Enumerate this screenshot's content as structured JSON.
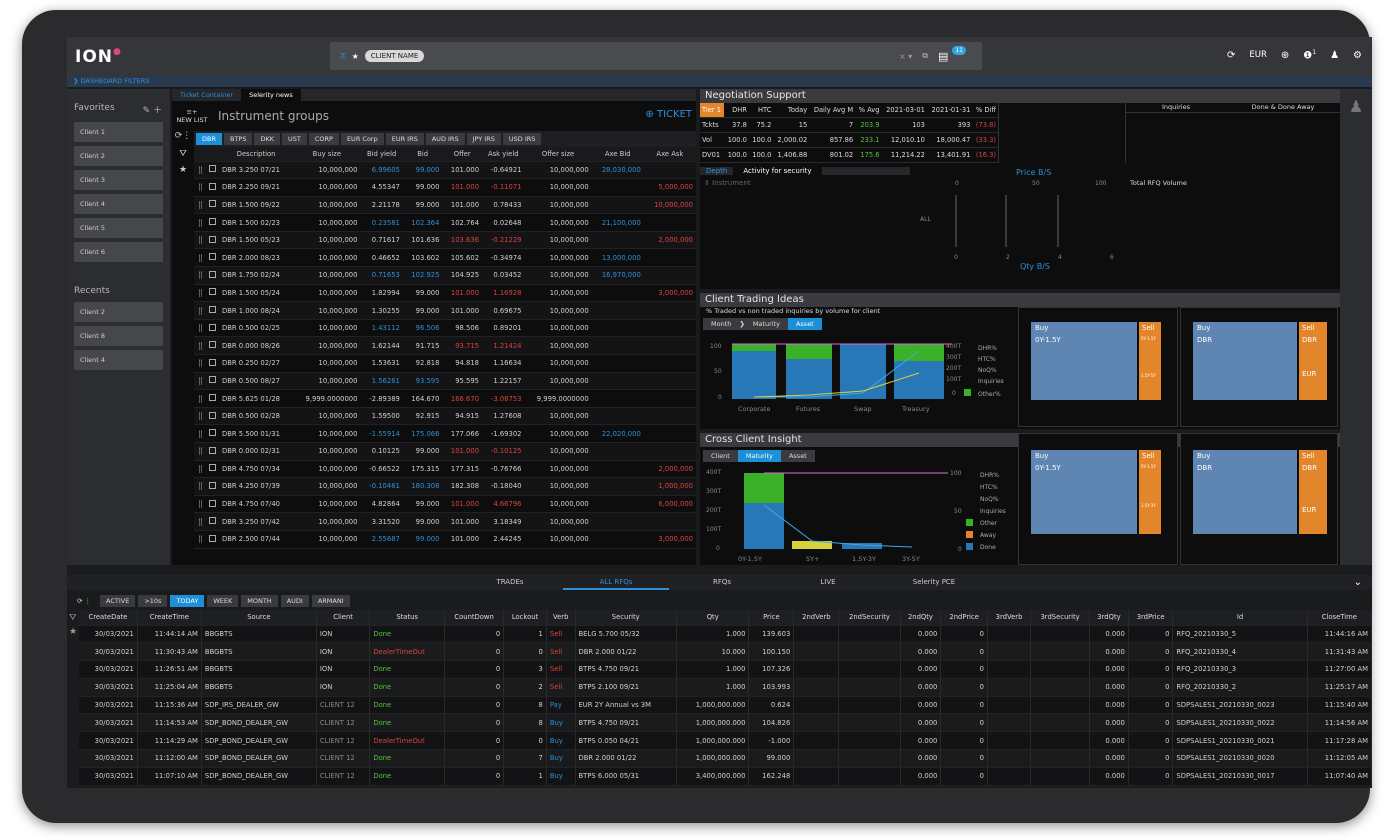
{
  "topbar": {
    "logo": "ION",
    "client_pill": "CLIENT NAME",
    "chat_badge": "11",
    "currency": "EUR",
    "alerts": "1"
  },
  "filterbar": {
    "label": "DASHBOARD FILTERS"
  },
  "sidebar": {
    "favorites_title": "Favorites",
    "favorites": [
      "Client 1",
      "Client 2",
      "Client 3",
      "Client 4",
      "Client 5",
      "Client 6"
    ],
    "recents_title": "Recents",
    "recents": [
      "Client 2",
      "Client 8",
      "Client 4"
    ]
  },
  "instruments": {
    "tabs": [
      "Ticket Container",
      "Selerity news"
    ],
    "new_list": "NEW LIST",
    "title": "Instrument groups",
    "ticket": "TICKET",
    "groups": [
      "DBR",
      "BTPS",
      "DKK",
      "UST",
      "CORP",
      "EUR Corp",
      "EUR IRS",
      "AUD IRS",
      "JPY IRS",
      "USD IRS"
    ],
    "columns": [
      "Description",
      "Buy size",
      "Bid yield",
      "Bid",
      "Offer",
      "Ask yield",
      "Offer size",
      "Axe Bid",
      "Axe Ask"
    ],
    "rows": [
      [
        "DBR 3.250 07/21",
        "10,000,000",
        "6.99605",
        "99.000",
        "101.000",
        "-0.64921",
        "10,000,000",
        "28,030,000",
        ""
      ],
      [
        "DBR 2.250 09/21",
        "10,000,000",
        "4.55347",
        "99.000",
        "101.000",
        "-0.11071",
        "10,000,000",
        "",
        "5,000,000"
      ],
      [
        "DBR 1.500 09/22",
        "10,000,000",
        "2.21178",
        "99.000",
        "101.000",
        "0.78433",
        "10,000,000",
        "",
        "10,000,000"
      ],
      [
        "DBR 1.500 02/23",
        "10,000,000",
        "0.23581",
        "102.364",
        "102.764",
        "0.02648",
        "10,000,000",
        "21,100,000",
        ""
      ],
      [
        "DBR 1.500 05/23",
        "10,000,000",
        "0.71617",
        "101.636",
        "103.636",
        "-0.21229",
        "10,000,000",
        "",
        "2,000,000"
      ],
      [
        "DBR 2.000 08/23",
        "10,000,000",
        "0.46652",
        "103.602",
        "105.602",
        "-0.34974",
        "10,000,000",
        "13,000,000",
        ""
      ],
      [
        "DBR 1.750 02/24",
        "10,000,000",
        "0.71653",
        "102.925",
        "104.925",
        "0.03452",
        "10,000,000",
        "16,970,000",
        ""
      ],
      [
        "DBR 1.500 05/24",
        "10,000,000",
        "1.82994",
        "99.000",
        "101.000",
        "1.16928",
        "10,000,000",
        "",
        "3,000,000"
      ],
      [
        "DBR 1.000 08/24",
        "10,000,000",
        "1.30255",
        "99.000",
        "101.000",
        "0.69675",
        "10,000,000",
        "",
        ""
      ],
      [
        "DBR 0.500 02/25",
        "10,000,000",
        "1.43112",
        "96.506",
        "98.506",
        "0.89201",
        "10,000,000",
        "",
        ""
      ],
      [
        "DBR 0.000 08/26",
        "10,000,000",
        "1.62144",
        "91.715",
        "93.715",
        "1.21424",
        "10,000,000",
        "",
        ""
      ],
      [
        "DBR 0.250 02/27",
        "10,000,000",
        "1.53631",
        "92.818",
        "94.818",
        "1.16634",
        "10,000,000",
        "",
        ""
      ],
      [
        "DBR 0.500 08/27",
        "10,000,000",
        "1.56261",
        "93.595",
        "95.595",
        "1.22157",
        "10,000,000",
        "",
        ""
      ],
      [
        "DBR 5.625 01/28",
        "9,999.0000000",
        "-2.89389",
        "164.670",
        "166.670",
        "-3.08753",
        "9,999.0000000",
        "",
        ""
      ],
      [
        "DBR 0.500 02/28",
        "10,000,000",
        "1.59500",
        "92.915",
        "94.915",
        "1.27608",
        "10,000,000",
        "",
        ""
      ],
      [
        "DBR 5.500 01/31",
        "10,000,000",
        "-1.55914",
        "175.066",
        "177.066",
        "-1.69302",
        "10,000,000",
        "22,020,000",
        ""
      ],
      [
        "DBR 0.000 02/31",
        "10,000,000",
        "0.10125",
        "99.000",
        "101.000",
        "-0.10125",
        "10,000,000",
        "",
        ""
      ],
      [
        "DBR 4.750 07/34",
        "10,000,000",
        "-0.66522",
        "175.315",
        "177.315",
        "-0.76766",
        "10,000,000",
        "",
        "2,000,000"
      ],
      [
        "DBR 4.250 07/39",
        "10,000,000",
        "-0.10461",
        "180.308",
        "182.308",
        "-0.18040",
        "10,000,000",
        "",
        "1,000,000"
      ],
      [
        "DBR 4.750 07/40",
        "10,000,000",
        "4.82864",
        "99.000",
        "101.000",
        "4.66796",
        "10,000,000",
        "",
        "6,000,000"
      ],
      [
        "DBR 3.250 07/42",
        "10,000,000",
        "3.31520",
        "99.000",
        "101.000",
        "3.18349",
        "10,000,000",
        "",
        ""
      ],
      [
        "DBR 2.500 07/44",
        "10,000,000",
        "2.55687",
        "99.000",
        "101.000",
        "2.44245",
        "10,000,000",
        "",
        "3,000,000"
      ]
    ]
  },
  "negotiation": {
    "title": "Negotiation Support",
    "header": [
      "Tier 1",
      "DHR",
      "HTC",
      "Today",
      "Daily Avg M",
      "% Avg",
      "2021-03-01",
      "2021-01-31",
      "% Diff"
    ],
    "rows": [
      [
        "Tckts",
        "37.8",
        "75.2",
        "15",
        "7",
        "203.9",
        "103",
        "393",
        "(73.8)"
      ],
      [
        "Vol",
        "100.0",
        "100.0",
        "2,000.02",
        "857.86",
        "233.1",
        "12,010.10",
        "18,000.47",
        "(33.3)"
      ],
      [
        "DV01",
        "100.0",
        "100.0",
        "1,406.88",
        "801.02",
        "175.6",
        "11,214.22",
        "13,401.91",
        "(16.3)"
      ]
    ],
    "inq_headers": [
      "Inquiries",
      "Done & Done Away"
    ],
    "depth_tabs": [
      "Depth",
      "Activity for security"
    ],
    "instrument_placeholder": "Instrument",
    "price_bs": "Price B/S",
    "qty_bs": "Qty B/S",
    "all": "ALL",
    "price_ticks": [
      "0",
      "50",
      "100"
    ],
    "qty_ticks": [
      "0",
      "2",
      "4",
      "6"
    ],
    "total_rfq": "Total RFQ Volume"
  },
  "ideas": {
    "title": "Client Trading Ideas",
    "subtitle": "% Traded vs non traded inquiries by volume for client",
    "crumbs": [
      "Month",
      "Maturity",
      "Asset"
    ],
    "categories": [
      "Corporate",
      "Futures",
      "Swap",
      "Treasury"
    ],
    "y_left": [
      "100",
      "50",
      "0"
    ],
    "y_right": [
      "400T",
      "300T",
      "200T",
      "100T",
      "0"
    ],
    "legend": [
      "DHR%",
      "HTC%",
      "NoQ%",
      "Inquiries",
      "Other%"
    ],
    "buy": "Buy",
    "sell": "Sell",
    "tenor1": "0Y-1.5Y",
    "sec1": "DBR",
    "sec2": "EUR",
    "sell_mini1": "0Y-1.5Y",
    "sell_mini2": "1.5Y-5Y"
  },
  "cross": {
    "title": "Cross Client Insight",
    "crumbs": [
      "Client",
      "Maturity",
      "Asset"
    ],
    "categories": [
      "0Y-1.5Y",
      "5Y+",
      "1.5Y-3Y",
      "3Y-5Y"
    ],
    "y_left": [
      "400T",
      "300T",
      "200T",
      "100T",
      "0"
    ],
    "y_right": [
      "100",
      "50",
      "0"
    ],
    "legend": [
      "DHR%",
      "HTC%",
      "NoQ%",
      "Inquiries",
      "Other",
      "Away",
      "Done"
    ],
    "buy": "Buy",
    "sell": "Sell",
    "tenor1": "0Y-1.5Y",
    "sec1": "DBR",
    "sec2": "EUR",
    "mini1": "5Y+",
    "mini2": "0Y-1.5Y",
    "mini3": "3Y-5Y",
    "mini4": "1.5Y-3Y"
  },
  "bottom": {
    "tabs": [
      "TRADEs",
      "ALL RFQs",
      "RFQs",
      "LIVE",
      "Selerity PCE"
    ],
    "filters": [
      "ACTIVE",
      ">10s",
      "TODAY",
      "WEEK",
      "MONTH",
      "AUDI",
      "ARMANI"
    ],
    "columns": [
      "CreateDate",
      "CreateTime",
      "Source",
      "Client",
      "Status",
      "CountDown",
      "Lockout",
      "Verb",
      "Security",
      "Qty",
      "Price",
      "2ndVerb",
      "2ndSecurity",
      "2ndQty",
      "2ndPrice",
      "3rdVerb",
      "3rdSecurity",
      "3rdQty",
      "3rdPrice",
      "Id",
      "CloseTime"
    ],
    "rows": [
      [
        "30/03/2021",
        "11:44:14 AM",
        "BBGBTS",
        "ION",
        "Done",
        "0",
        "1",
        "Sell",
        "BELG 5.700 05/32",
        "1.000",
        "139.603",
        "",
        "",
        "0.000",
        "0",
        "",
        "",
        "0.000",
        "0",
        "RFQ_20210330_5",
        "11:44:16 AM"
      ],
      [
        "30/03/2021",
        "11:30:43 AM",
        "BBGBTS",
        "ION",
        "DealerTimeOut",
        "0",
        "0",
        "Sell",
        "DBR 2.000 01/22",
        "10.000",
        "100.150",
        "",
        "",
        "0.000",
        "0",
        "",
        "",
        "0.000",
        "0",
        "RFQ_20210330_4",
        "11:31:43 AM"
      ],
      [
        "30/03/2021",
        "11:26:51 AM",
        "BBGBTS",
        "ION",
        "Done",
        "0",
        "3",
        "Sell",
        "BTPS 4.750 09/21",
        "1.000",
        "107.326",
        "",
        "",
        "0.000",
        "0",
        "",
        "",
        "0.000",
        "0",
        "RFQ_20210330_3",
        "11:27:00 AM"
      ],
      [
        "30/03/2021",
        "11:25:04 AM",
        "BBGBTS",
        "ION",
        "Done",
        "0",
        "2",
        "Sell",
        "BTPS 2.100 09/21",
        "1.000",
        "103.993",
        "",
        "",
        "0.000",
        "0",
        "",
        "",
        "0.000",
        "0",
        "RFQ_20210330_2",
        "11:25:17 AM"
      ],
      [
        "30/03/2021",
        "11:15:36 AM",
        "SDP_IRS_DEALER_GW",
        "CLIENT 12",
        "Done",
        "0",
        "8",
        "Pay",
        "EUR 2Y Annual vs 3M",
        "1,000,000.000",
        "0.624",
        "",
        "",
        "0.000",
        "0",
        "",
        "",
        "0.000",
        "0",
        "SDPSALES1_20210330_0023",
        "11:15:40 AM"
      ],
      [
        "30/03/2021",
        "11:14:53 AM",
        "SDP_BOND_DEALER_GW",
        "CLIENT 12",
        "Done",
        "0",
        "8",
        "Buy",
        "BTPS 4.750 09/21",
        "1,000,000.000",
        "104.826",
        "",
        "",
        "0.000",
        "0",
        "",
        "",
        "0.000",
        "0",
        "SDPSALES1_20210330_0022",
        "11:14:56 AM"
      ],
      [
        "30/03/2021",
        "11:14:29 AM",
        "SDP_BOND_DEALER_GW",
        "CLIENT 12",
        "DealerTimeOut",
        "0",
        "0",
        "Buy",
        "BTPS 0.050 04/21",
        "1,000,000.000",
        "-1.000",
        "",
        "",
        "0.000",
        "0",
        "",
        "",
        "0.000",
        "0",
        "SDPSALES1_20210330_0021",
        "11:17:28 AM"
      ],
      [
        "30/03/2021",
        "11:12:00 AM",
        "SDP_BOND_DEALER_GW",
        "CLIENT 12",
        "Done",
        "0",
        "7",
        "Buy",
        "DBR 2.000 01/22",
        "1,000,000.000",
        "99.000",
        "",
        "",
        "0.000",
        "0",
        "",
        "",
        "0.000",
        "0",
        "SDPSALES1_20210330_0020",
        "11:12:05 AM"
      ],
      [
        "30/03/2021",
        "11:07:10 AM",
        "SDP_BOND_DEALER_GW",
        "CLIENT 12",
        "Done",
        "0",
        "1",
        "Buy",
        "BTPS 6.000 05/31",
        "3,400,000.000",
        "162.248",
        "",
        "",
        "0.000",
        "0",
        "",
        "",
        "0.000",
        "0",
        "SDPSALES1_20210330_0017",
        "11:07:40 AM"
      ]
    ]
  },
  "colors": {
    "accent": "#1b8fd8",
    "buy": "#5f86b2",
    "sell": "#e3852a",
    "sell_text": "#d9443b",
    "done": "#56c43a"
  }
}
